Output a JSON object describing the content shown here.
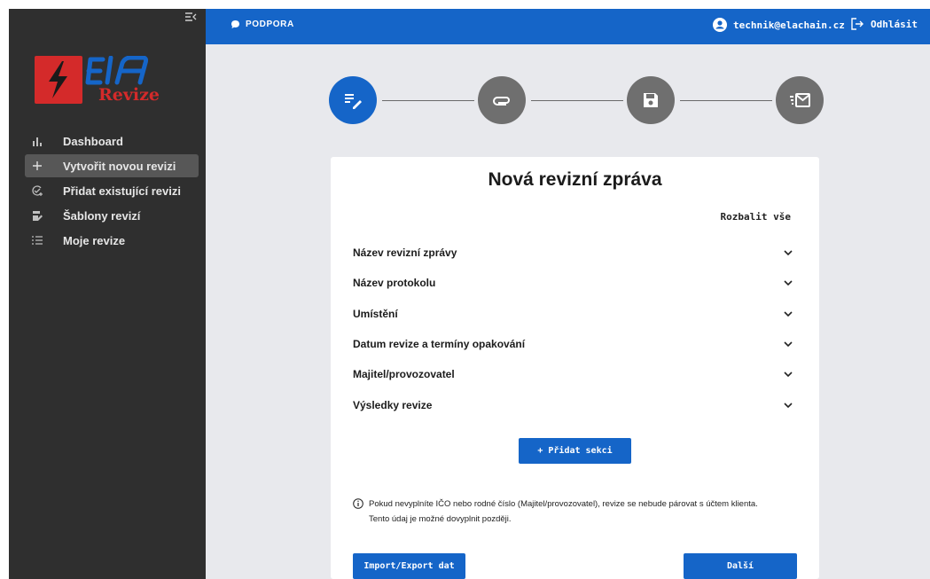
{
  "sidebar": {
    "logo": {
      "wordmark": "ElA",
      "subtitle": "Revize",
      "colors": {
        "red": "#d42a2a",
        "blue": "#1565c8"
      }
    },
    "items": [
      {
        "label": "Dashboard",
        "icon": "bar-chart-icon"
      },
      {
        "label": "Vytvořit novou revizi",
        "icon": "plus-icon",
        "active": true
      },
      {
        "label": "Přidat existující revizi",
        "icon": "add-check-icon"
      },
      {
        "label": "Šablony revizí",
        "icon": "template-edit-icon"
      },
      {
        "label": "Moje revize",
        "icon": "list-icon"
      }
    ]
  },
  "topbar": {
    "support_label": "PODPORA",
    "user_email": "technik@elachain.cz",
    "logout_label": "Odhlásit",
    "color": "#1565c8"
  },
  "stepper": {
    "steps": [
      {
        "icon": "edit-notes-icon",
        "state": "active"
      },
      {
        "icon": "attachment-icon",
        "state": "inactive"
      },
      {
        "icon": "save-icon",
        "state": "inactive"
      },
      {
        "icon": "send-mail-icon",
        "state": "inactive"
      }
    ]
  },
  "form": {
    "title": "Nová revizní zpráva",
    "expand_all": "Rozbalit vše",
    "sections": [
      "Název revizní zprávy",
      "Název protokolu",
      "Umístění",
      "Datum revize a termíny opakování",
      "Majitel/provozovatel",
      "Výsledky revize"
    ],
    "add_section": "+ Přidat sekci",
    "note_line1": "Pokud nevyplníte IČO nebo rodné číslo (Majitel/provozovatel), revize se nebude párovat s účtem klienta.",
    "note_line2": "Tento údaj je možné dovyplnit později.",
    "import_export": "Import/Export dat",
    "next": "Další"
  }
}
